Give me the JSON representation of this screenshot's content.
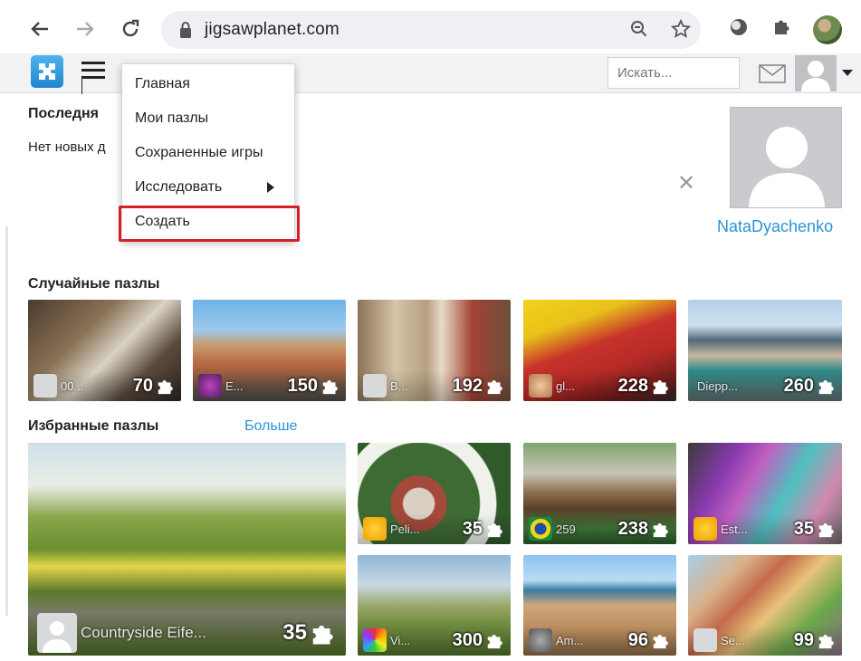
{
  "browser": {
    "url": "jigsawplanet.com",
    "back_icon": "arrow-left-icon",
    "forward_icon": "arrow-right-icon",
    "reload_icon": "reload-icon"
  },
  "header": {
    "search_placeholder": "Искать..."
  },
  "menu": {
    "items": [
      {
        "label": "Главная"
      },
      {
        "label": "Мои пазлы"
      },
      {
        "label": "Сохраненные игры"
      },
      {
        "label": "Исследовать"
      },
      {
        "label": "Создать"
      }
    ],
    "highlight_color": "#d61f26"
  },
  "recent": {
    "title": "Последня",
    "empty_text": "Нет новых д"
  },
  "user_card": {
    "name": "NataDyachenko"
  },
  "random": {
    "title": "Случайные пазлы",
    "tiles": [
      {
        "user": "00...",
        "count": "70"
      },
      {
        "user": "E...",
        "count": "150"
      },
      {
        "user": "B...",
        "count": "192"
      },
      {
        "user": "gl...",
        "count": "228"
      },
      {
        "user": "Diepp...",
        "count": "260"
      }
    ]
  },
  "featured": {
    "title": "Избранные пазлы",
    "more_label": "Больше",
    "big_tile": {
      "user": "Countryside Eife...",
      "count": "35"
    },
    "tiles": [
      {
        "user": "Peli...",
        "count": "35"
      },
      {
        "user": "259",
        "count": "238"
      },
      {
        "user": "Est...",
        "count": "35"
      },
      {
        "user": "Vi...",
        "count": "300"
      },
      {
        "user": "Am...",
        "count": "96"
      },
      {
        "user": "Se...",
        "count": "99"
      }
    ]
  },
  "colors": {
    "link": "#2a93d5",
    "logo": "#1f86cf"
  }
}
